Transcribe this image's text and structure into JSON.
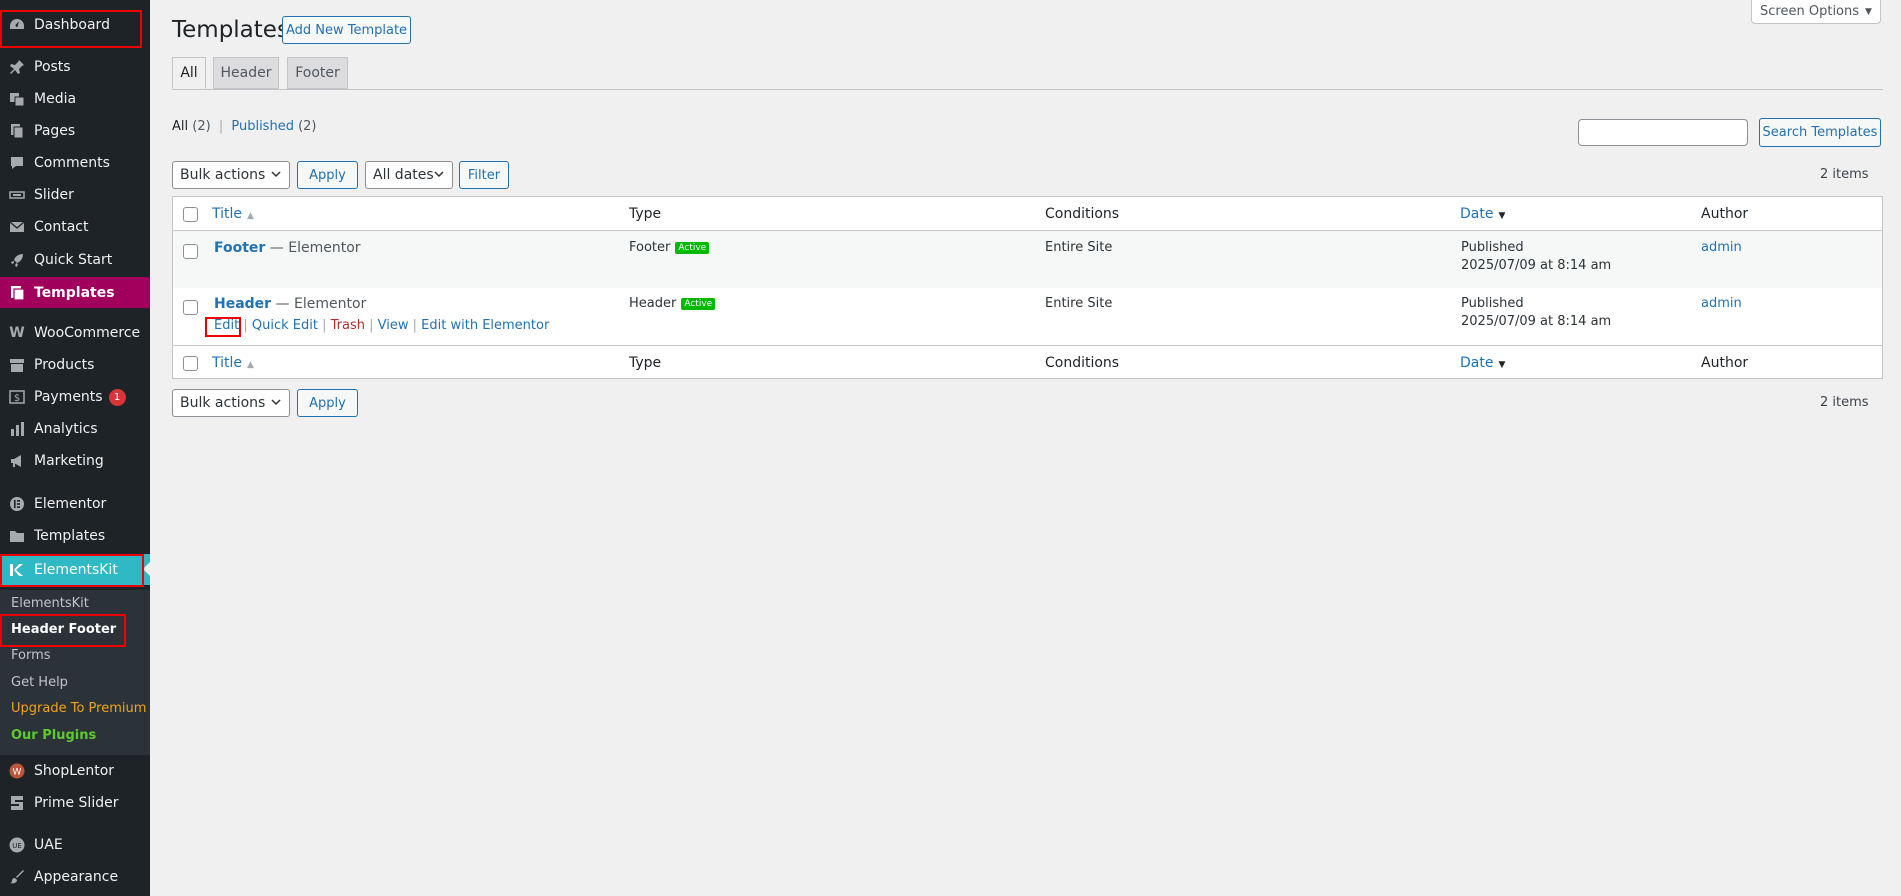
{
  "sidebar": {
    "menu": {
      "dashboard": "Dashboard",
      "posts": "Posts",
      "media": "Media",
      "pages": "Pages",
      "comments": "Comments",
      "slider": "Slider",
      "contact": "Contact",
      "quick_start": "Quick Start",
      "templates": "Templates",
      "woocommerce": "WooCommerce",
      "products": "Products",
      "payments": "Payments",
      "payments_badge": "1",
      "analytics": "Analytics",
      "marketing": "Marketing",
      "elementor": "Elementor",
      "elementor_templates": "Templates",
      "elementskit": "ElementsKit",
      "shoplentor": "ShopLentor",
      "prime_slider": "Prime Slider",
      "uae": "UAE",
      "appearance": "Appearance"
    },
    "submenu": {
      "elementskit": "ElementsKit",
      "header_footer": "Header Footer",
      "forms": "Forms",
      "get_help": "Get Help",
      "upgrade": "Upgrade To Premium",
      "our_plugins": "Our Plugins"
    }
  },
  "header": {
    "title": "Templates",
    "add_new": "Add New Template",
    "screen_options": "Screen Options"
  },
  "tabs": [
    "All",
    "Header",
    "Footer"
  ],
  "filters": {
    "all_label": "All",
    "all_count": "(2)",
    "published_label": "Published",
    "published_count": "(2)",
    "separator": "|"
  },
  "search": {
    "button": "Search Templates",
    "placeholder": ""
  },
  "toolbar": {
    "bulk_actions": "Bulk actions",
    "apply": "Apply",
    "all_dates": "All dates",
    "filter": "Filter",
    "items_count": "2 items"
  },
  "table": {
    "columns": {
      "title": "Title",
      "type": "Type",
      "conditions": "Conditions",
      "date": "Date",
      "author": "Author"
    },
    "rows": [
      {
        "title": "Footer",
        "suffix": " — Elementor",
        "type": "Footer",
        "badge": "Active",
        "conditions": "Entire Site",
        "status": "Published",
        "date": "2025/07/09 at 8:14 am",
        "author": "admin"
      },
      {
        "title": "Header",
        "suffix": " — Elementor",
        "type": "Header",
        "badge": "Active",
        "conditions": "Entire Site",
        "status": "Published",
        "date": "2025/07/09 at 8:14 am",
        "author": "admin",
        "actions": {
          "edit": "Edit",
          "quick_edit": "Quick Edit",
          "trash": "Trash",
          "view": "View",
          "edit_elementor": "Edit with Elementor",
          "sep": "|"
        }
      }
    ]
  },
  "icons": {
    "dashboard": "dashboard-icon",
    "posts": "pin-icon",
    "media": "media-icon",
    "pages": "pages-icon",
    "comments": "comment-icon",
    "slider": "slider-icon",
    "contact": "mail-icon",
    "quick_start": "rocket-icon",
    "templates": "templates-icon",
    "woocommerce": "woo-icon",
    "products": "box-icon",
    "payments": "dollar-icon",
    "analytics": "bar-chart-icon",
    "marketing": "megaphone-icon",
    "elementor": "elementor-icon",
    "folder": "folder-icon",
    "elementskit": "ekit-icon",
    "shoplentor": "shoplentor-icon",
    "prime_slider": "prime-slider-icon",
    "uae": "uae-icon",
    "appearance": "brush-icon"
  },
  "colors": {
    "sidebar_bg": "#1d2327",
    "active_menu": "#a0005c",
    "elementskit_menu": "#2fb9c4",
    "link": "#2271b1",
    "badge_active": "#00b900",
    "highlight": "#e00000"
  }
}
